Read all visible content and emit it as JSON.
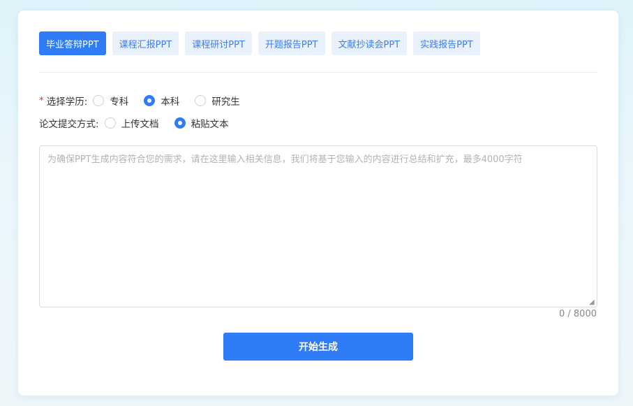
{
  "tabs": [
    {
      "label": "毕业答辩PPT",
      "active": true
    },
    {
      "label": "课程汇报PPT",
      "active": false
    },
    {
      "label": "课程研讨PPT",
      "active": false
    },
    {
      "label": "开题报告PPT",
      "active": false
    },
    {
      "label": "文献抄读会PPT",
      "active": false
    },
    {
      "label": "实践报告PPT",
      "active": false
    }
  ],
  "education": {
    "required_mark": "*",
    "label": "选择学历:",
    "options": [
      {
        "label": "专科",
        "selected": false
      },
      {
        "label": "本科",
        "selected": true
      },
      {
        "label": "研究生",
        "selected": false
      }
    ]
  },
  "submission": {
    "label": "论文提交方式:",
    "options": [
      {
        "label": "上传文档",
        "selected": false
      },
      {
        "label": "粘贴文本",
        "selected": true
      }
    ]
  },
  "content_input": {
    "value": "",
    "placeholder": "为确保PPT生成内容符合您的需求，请在这里输入相关信息，我们将基于您输入的内容进行总结和扩充，最多4000字符"
  },
  "counter": "0 / 8000",
  "submit_label": "开始生成",
  "colors": {
    "accent": "#2f7cf6",
    "tab_bg": "#e9f1fd",
    "required": "#ee3333"
  }
}
